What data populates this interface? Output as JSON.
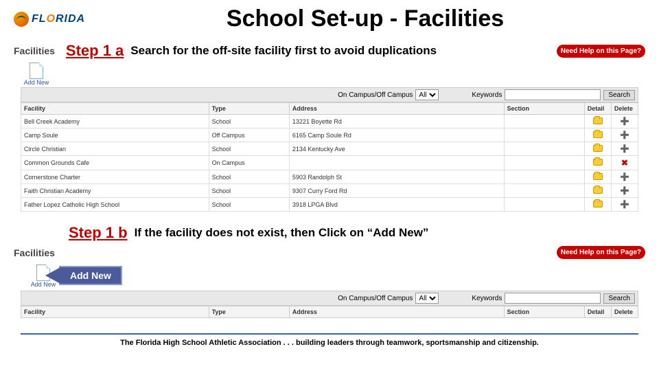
{
  "title": "School Set-up - Facilities",
  "logo_text_parts": {
    "f": "FL",
    "o": "O",
    "rida": "RIDA"
  },
  "help_button": "Need Help on this Page?",
  "section_label": "Facilities",
  "add_new_link": "Add New",
  "filter": {
    "dropdown_label": "On Campus/Off Campus",
    "dropdown_value": "All",
    "keywords_label": "Keywords",
    "keywords_value": "",
    "search_button": "Search"
  },
  "grid_headers": {
    "facility": "Facility",
    "type": "Type",
    "address": "Address",
    "section": "Section",
    "detail": "Detail",
    "delete": "Delete"
  },
  "step1a": {
    "badge": "Step 1 a",
    "text": "Search for the off-site facility first to avoid duplications"
  },
  "step1b": {
    "badge": "Step 1 b",
    "text": "If the facility does not exist, then Click on “Add New”",
    "callout": "Add New"
  },
  "rows_a": [
    {
      "facility": "Bell Creek Academy",
      "type": "School",
      "address": "13221 Boyette Rd",
      "deletable": false
    },
    {
      "facility": "Camp Soule",
      "type": "Off Campus",
      "address": "6165 Camp Soule Rd",
      "deletable": false
    },
    {
      "facility": "Circle Christian",
      "type": "School",
      "address": "2134 Kentucky Ave",
      "deletable": false
    },
    {
      "facility": "Common Grounds Cafe",
      "type": "On Campus",
      "address": "",
      "deletable": true
    },
    {
      "facility": "Cornerstone Charter",
      "type": "School",
      "address": "5903 Randolph St",
      "deletable": false
    },
    {
      "facility": "Faith Christian Academy",
      "type": "School",
      "address": "9307 Curry Ford Rd",
      "deletable": false
    },
    {
      "facility": "Father Lopez Catholic High School",
      "type": "School",
      "address": "3918 LPGA Blvd",
      "deletable": false
    }
  ],
  "footer": "The Florida High School Athletic Association . . . building leaders through teamwork, sportsmanship and citizenship."
}
